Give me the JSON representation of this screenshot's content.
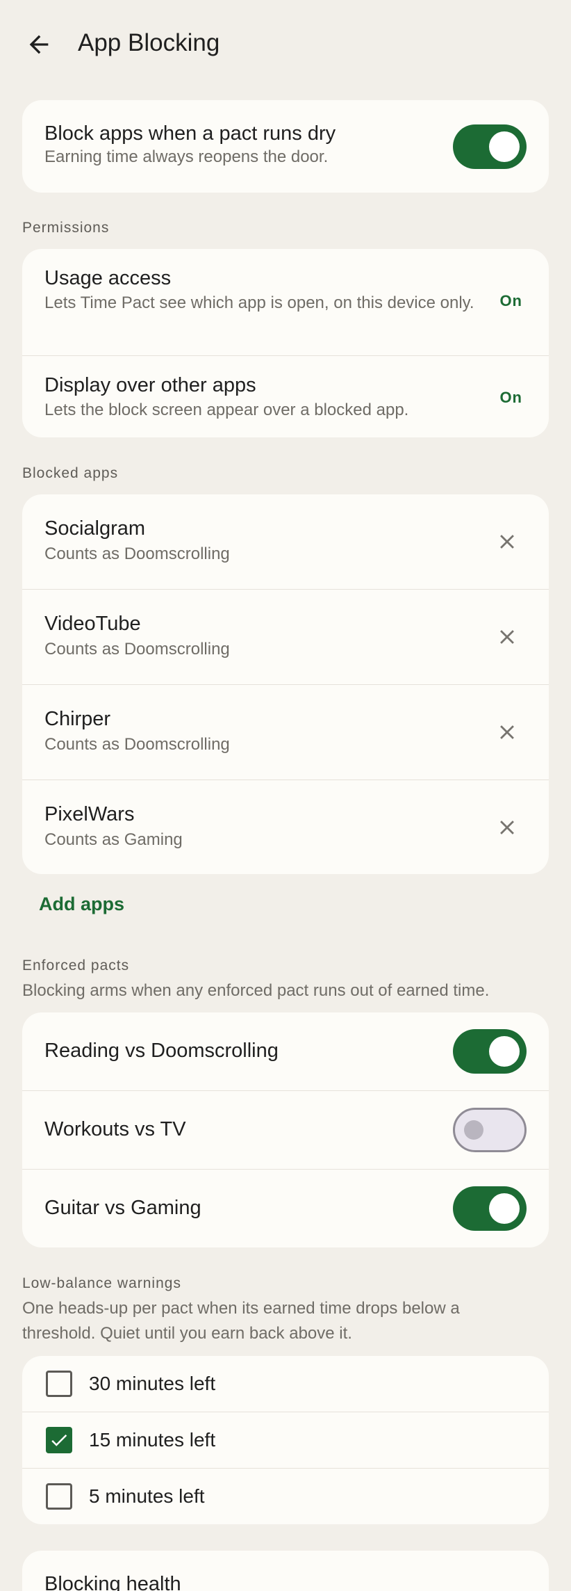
{
  "appbar": {
    "title": "App Blocking",
    "back_icon": "arrow-back-icon"
  },
  "master": {
    "title": "Block apps when a pact runs dry",
    "subtitle": "Earning time always reopens the door.",
    "enabled": true
  },
  "permissions": {
    "label": "Permissions",
    "items": [
      {
        "title": "Usage access",
        "subtitle": "Lets Time Pact see which app is open, on this device only.",
        "status": "On"
      },
      {
        "title": "Display over other apps",
        "subtitle": "Lets the block screen appear over a blocked app.",
        "status": "On"
      }
    ]
  },
  "blocked_apps": {
    "label": "Blocked apps",
    "items": [
      {
        "name": "Socialgram",
        "category": "Counts as Doomscrolling"
      },
      {
        "name": "VideoTube",
        "category": "Counts as Doomscrolling"
      },
      {
        "name": "Chirper",
        "category": "Counts as Doomscrolling"
      },
      {
        "name": "PixelWars",
        "category": "Counts as Gaming"
      }
    ],
    "add_label": "Add apps"
  },
  "enforced_pacts": {
    "label": "Enforced pacts",
    "description": "Blocking arms when any enforced pact runs out of earned time.",
    "items": [
      {
        "name": "Reading vs Doomscrolling",
        "enabled": true
      },
      {
        "name": "Workouts vs TV",
        "enabled": false
      },
      {
        "name": "Guitar vs Gaming",
        "enabled": true
      }
    ]
  },
  "warnings": {
    "label": "Low-balance warnings",
    "description": "One heads-up per pact when its earned time drops below a threshold. Quiet until you earn back above it.",
    "items": [
      {
        "label": "30 minutes left",
        "checked": false
      },
      {
        "label": "15 minutes left",
        "checked": true
      },
      {
        "label": "5 minutes left",
        "checked": false
      }
    ]
  },
  "health": {
    "title": "Blocking health"
  },
  "colors": {
    "accent": "#1c6b34",
    "background": "#f2efe9",
    "card": "#fdfcf8"
  }
}
